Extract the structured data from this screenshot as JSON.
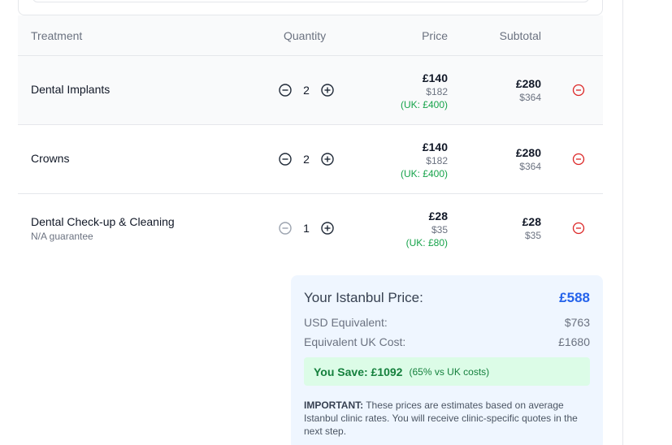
{
  "table": {
    "headers": {
      "treatment": "Treatment",
      "quantity": "Quantity",
      "price": "Price",
      "subtotal": "Subtotal"
    },
    "rows": [
      {
        "name": "Dental Implants",
        "note": "",
        "quantity": "2",
        "price_gbp": "£140",
        "price_usd": "$182",
        "price_uk": "(UK: £400)",
        "subtotal_gbp": "£280",
        "subtotal_usd": "$364",
        "decrease_enabled": true
      },
      {
        "name": "Crowns",
        "note": "",
        "quantity": "2",
        "price_gbp": "£140",
        "price_usd": "$182",
        "price_uk": "(UK: £400)",
        "subtotal_gbp": "£280",
        "subtotal_usd": "$364",
        "decrease_enabled": true
      },
      {
        "name": "Dental Check-up & Cleaning",
        "note": "N/A guarantee",
        "quantity": "1",
        "price_gbp": "£28",
        "price_usd": "$35",
        "price_uk": "(UK: £80)",
        "subtotal_gbp": "£28",
        "subtotal_usd": "$35",
        "decrease_enabled": false
      }
    ]
  },
  "summary": {
    "istanbul_label": "Your Istanbul Price:",
    "istanbul_value": "£588",
    "usd_label": "USD Equivalent:",
    "usd_value": "$763",
    "uk_label": "Equivalent UK Cost:",
    "uk_value": "£1680",
    "save_amount": "You Save: £1092",
    "save_percent": "(65% vs UK costs)",
    "important_label": "IMPORTANT:",
    "important_text": " These prices are estimates based on average Istanbul clinic rates. You will receive clinic-specific quotes in the next step."
  },
  "colors": {
    "accent_blue": "#2563eb",
    "savings_green": "#15803d",
    "uk_price_green": "#16a34a",
    "remove_red": "#dc2626",
    "summary_bg": "#eff6ff"
  },
  "icons": {
    "decrease": "minus-circle-icon",
    "increase": "plus-circle-icon",
    "remove": "remove-circle-icon"
  }
}
